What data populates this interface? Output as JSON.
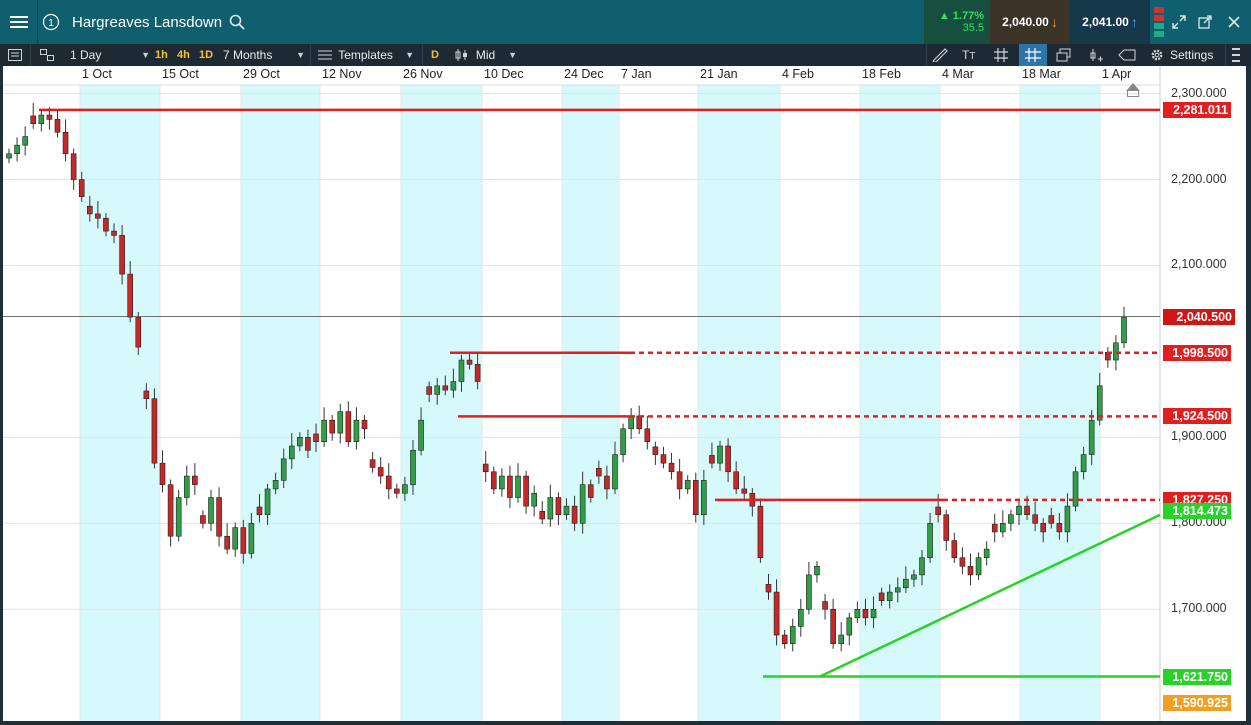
{
  "header": {
    "instrument": "Hargreaves Lansdown",
    "change_pct": "1.77%",
    "change_pts": "35.5",
    "sell_price": "2,040.00",
    "buy_price": "2,041.00"
  },
  "toolbar": {
    "interval": "1 Day",
    "quick_intervals": [
      "1h",
      "4h",
      "1D"
    ],
    "range": "7 Months",
    "templates": "Templates",
    "d_badge": "D",
    "price_type": "Mid",
    "settings": "Settings"
  },
  "colors": {
    "header_bg": "#0f5f6e",
    "toolbar_bg": "#1e2a33",
    "up_candle": "#2f9e44",
    "down_candle": "#c62828",
    "resistance": "#e02020",
    "support": "#28d228",
    "shaded_band": "#d6fafc"
  },
  "chart_data": {
    "type": "candlestick",
    "y_axis_ticks": [
      "2,300.000",
      "2,200.000",
      "2,100.000",
      "1,900.000",
      "1,800.000",
      "1,700.000"
    ],
    "y_axis_values": [
      2300,
      2200,
      2100,
      1900,
      1800,
      1700
    ],
    "x_axis_ticks": [
      "1 Oct",
      "15 Oct",
      "29 Oct",
      "12 Nov",
      "26 Nov",
      "10 Dec",
      "24 Dec",
      "7 Jan",
      "21 Jan",
      "4 Feb",
      "18 Feb",
      "4 Mar",
      "18 Mar",
      "1 Apr"
    ],
    "ylim": [
      1570,
      2310
    ],
    "current_price": "2,040.500",
    "current_value": 2040.5,
    "levels": [
      {
        "label": "2,281.011",
        "value": 2281.011,
        "color": "#e02020"
      },
      {
        "label": "1,998.500",
        "value": 1998.5,
        "color": "#e02020"
      },
      {
        "label": "1,924.500",
        "value": 1924.5,
        "color": "#e02020"
      },
      {
        "label": "1,827.250",
        "value": 1827.25,
        "color": "#e02020"
      },
      {
        "label": "1,814.473",
        "value": 1814.473,
        "color": "#28d228"
      },
      {
        "label": "1,621.750",
        "value": 1621.75,
        "color": "#28d228"
      },
      {
        "label": "1,590.925",
        "value": 1590.925,
        "color": "#f0a020"
      }
    ],
    "closes": [
      2230,
      2240,
      2250,
      2265,
      2275,
      2270,
      2255,
      2230,
      2200,
      2180,
      2160,
      2155,
      2140,
      2135,
      2090,
      2040,
      2005,
      1945,
      1870,
      1845,
      1785,
      1830,
      1855,
      1845,
      1800,
      1830,
      1785,
      1770,
      1795,
      1765,
      1800,
      1810,
      1840,
      1850,
      1875,
      1890,
      1900,
      1885,
      1895,
      1920,
      1905,
      1930,
      1895,
      1920,
      1910,
      1865,
      1855,
      1840,
      1835,
      1845,
      1885,
      1920,
      1950,
      1960,
      1955,
      1965,
      1990,
      1985,
      1965,
      1860,
      1840,
      1855,
      1830,
      1855,
      1820,
      1835,
      1805,
      1830,
      1810,
      1820,
      1800,
      1845,
      1830,
      1855,
      1840,
      1880,
      1910,
      1925,
      1910,
      1895,
      1880,
      1870,
      1860,
      1840,
      1850,
      1810,
      1850,
      1870,
      1890,
      1860,
      1840,
      1835,
      1820,
      1760,
      1720,
      1670,
      1660,
      1680,
      1700,
      1740,
      1750,
      1700,
      1660,
      1670,
      1690,
      1700,
      1690,
      1700,
      1710,
      1720,
      1725,
      1735,
      1740,
      1760,
      1800,
      1810,
      1780,
      1760,
      1750,
      1740,
      1760,
      1770,
      1790,
      1800,
      1810,
      1820,
      1810,
      1800,
      1790,
      1800,
      1790,
      1820,
      1860,
      1880,
      1920,
      1960,
      1990,
      2010,
      2040
    ]
  }
}
